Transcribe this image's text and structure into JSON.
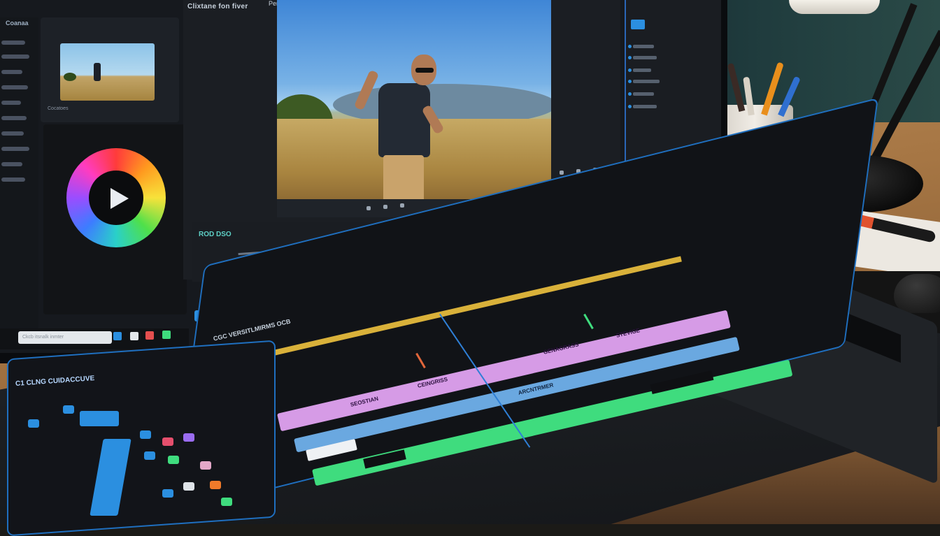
{
  "viewer": {
    "title": "Clixtane fon fiver",
    "title_extra": "Pemiliaiv"
  },
  "sidebar": {
    "brand": "Coanaa",
    "items": [
      "",
      "",
      "",
      "",
      "",
      "",
      "",
      "",
      "",
      "",
      "",
      ""
    ]
  },
  "media_bin": {
    "label": "Cocatoes"
  },
  "color_wheel": {
    "icon": "play-icon"
  },
  "mini_timeline": {
    "label": "ROD DSO"
  },
  "taskbar": {
    "search_placeholder": "Ckcb itsnalk inmter"
  },
  "timeline": {
    "title": "CGC VERSITLMIRMS OCB",
    "clips": [
      {
        "track": "v2",
        "label": "SEOSTIAN",
        "color": "#d69be6"
      },
      {
        "track": "v2",
        "label": "CEINGRISS",
        "color": "#d69be6"
      },
      {
        "track": "v2",
        "label": "GENAGRASS",
        "color": "#d69be6"
      },
      {
        "track": "v2",
        "label": "STEVIGE",
        "color": "#d69be6"
      },
      {
        "track": "v1",
        "label": "ARCNTRMER",
        "color": "#6aa8e0"
      },
      {
        "track": "a1",
        "label": "",
        "color": "#3fdc7e"
      }
    ]
  },
  "pad": {
    "header": "C1 CLNG CUIDACCUVE"
  },
  "colors": {
    "accent": "#1f6fbf",
    "clip_purple": "#d69be6",
    "clip_blue": "#6aa8e0",
    "clip_green": "#3fdc7e",
    "ruler": "#d9b13a"
  }
}
